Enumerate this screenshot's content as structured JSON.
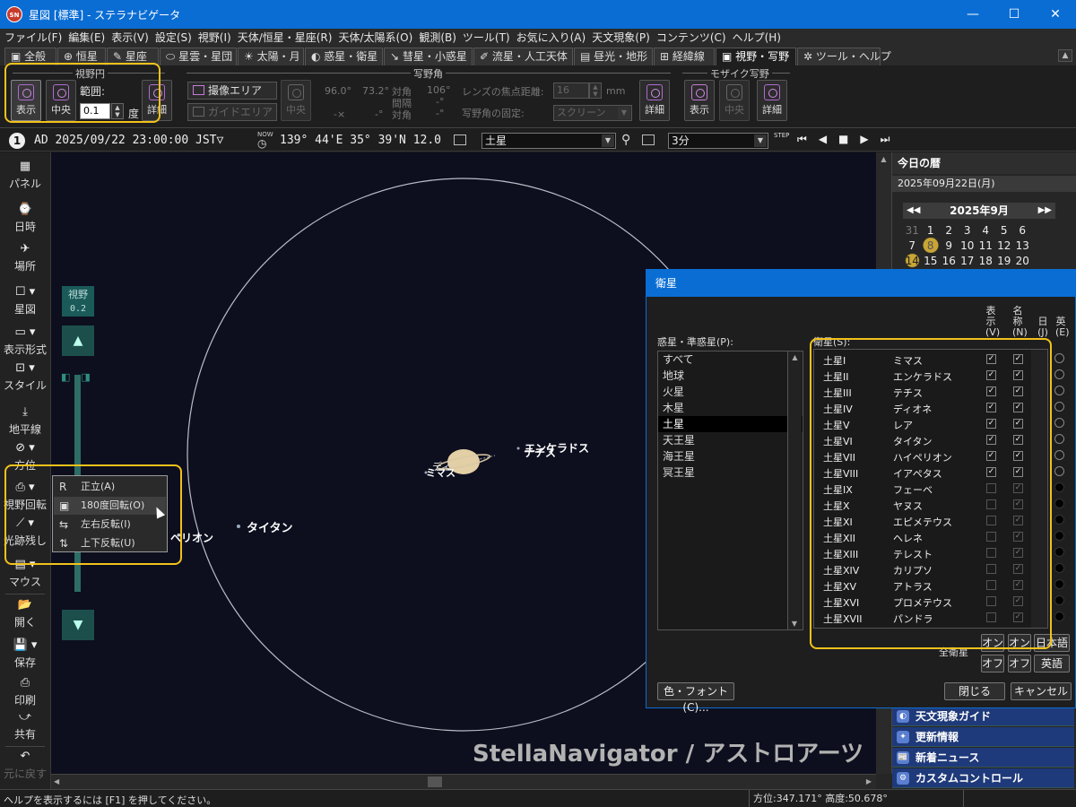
{
  "window": {
    "title": "星図 [標準] - ステラナビゲータ",
    "app_icon": "SN"
  },
  "menu": [
    "ファイル(F)",
    "編集(E)",
    "表示(V)",
    "設定(S)",
    "視野(I)",
    "天体/恒星・星座(R)",
    "天体/太陽系(O)",
    "観測(B)",
    "ツール(T)",
    "お気に入り(A)",
    "天文現象(P)",
    "コンテンツ(C)",
    "ヘルプ(H)"
  ],
  "tabs": [
    "全般",
    "恒星",
    "星座",
    "星雲・星団",
    "太陽・月",
    "惑星・衛星",
    "彗星・小惑星",
    "流星・人工天体",
    "昼光・地形",
    "経緯線",
    "視野・写野",
    "ツール・ヘルプ"
  ],
  "active_tab": "視野・写野",
  "ribbon": {
    "fov_circle": {
      "title": "視野円",
      "show": "表示",
      "center": "中央",
      "range_label": "範囲:",
      "range_value": "0.1",
      "unit": "度",
      "detail": "詳細"
    },
    "photo_field": {
      "title": "写野角",
      "capture_area": "撮像エリア",
      "guide_area": "ガイドエリア",
      "center": "中央",
      "w_deg": "96.0°",
      "h_deg": "73.2°",
      "w_x": "-×",
      "h_x": "-°",
      "diag_label": "対角",
      "spacing_label": "間隔",
      "diag_label2": "対角",
      "diag_val": "106°",
      "spacing_val": "-°",
      "diag_val2": "-°",
      "focal_label": "レンズの焦点距離:",
      "focal_value": "16",
      "focal_unit": "mm",
      "fixed_label": "写野角の固定:",
      "fixed_value": "スクリーン",
      "detail": "詳細"
    },
    "mosaic": {
      "title": "モザイク写野",
      "show": "表示",
      "center": "中央",
      "detail": "詳細"
    }
  },
  "status": {
    "step": "1",
    "datetime": "AD 2025/09/22 23:00:00 JST▽",
    "now_label": "NOW",
    "coords": "139° 44'E  35° 39'N  12.0",
    "target": "土星",
    "interval": "3分",
    "step_label": "STEP"
  },
  "leftbar": [
    "パネル",
    "日時",
    "場所",
    "星図",
    "表示形式",
    "スタイル",
    "地平線",
    "方位",
    "視野回転",
    "光跡残し",
    "マウス",
    "開く",
    "保存",
    "印刷",
    "共有",
    "元に戻す"
  ],
  "fov_indicator": {
    "label": "視野",
    "value": "0.2"
  },
  "context_menu": [
    "正立(A)",
    "180度回転(O)",
    "左右反転(I)",
    "上下反転(U)"
  ],
  "sky_labels": {
    "titan": "タイタン",
    "hyperion_partial": "ペリオン",
    "mimas": "ミマス",
    "dione_partial": "ディ",
    "enceladus": "エンケラドス",
    "tethys": "テチス"
  },
  "watermark": "StellaNavigator / アストロアーツ",
  "right_panel": {
    "header": "今日の暦",
    "date": "2025年09月22日(月)",
    "month": "2025年9月",
    "cal_rows": [
      [
        "31",
        "1",
        "2",
        "3",
        "4",
        "5",
        "6"
      ],
      [
        "7",
        "8",
        "9",
        "10",
        "11",
        "12",
        "13"
      ],
      [
        "14",
        "15",
        "16",
        "17",
        "18",
        "19",
        "20"
      ]
    ],
    "links": [
      "天文現象ガイド",
      "更新情報",
      "新着ニュース",
      "カスタムコントロール"
    ]
  },
  "dialog": {
    "title": "衛星",
    "planets_label": "惑星・準惑星(P):",
    "planets": [
      "すべて",
      "地球",
      "火星",
      "木星",
      "土星",
      "天王星",
      "海王星",
      "冥王星"
    ],
    "selected_planet": "土星",
    "sats_label": "衛星(S):",
    "col_show": "表示(V)",
    "col_name": "名称(N)",
    "col_jp": "日(J)",
    "col_en": "英(E)",
    "satellites": [
      {
        "id": "土星I",
        "name": "ミマス",
        "show": true
      },
      {
        "id": "土星II",
        "name": "エンケラドス",
        "show": true
      },
      {
        "id": "土星III",
        "name": "テチス",
        "show": true
      },
      {
        "id": "土星IV",
        "name": "ディオネ",
        "show": true
      },
      {
        "id": "土星V",
        "name": "レア",
        "show": true
      },
      {
        "id": "土星VI",
        "name": "タイタン",
        "show": true
      },
      {
        "id": "土星VII",
        "name": "ハイペリオン",
        "show": true
      },
      {
        "id": "土星VIII",
        "name": "イアペタス",
        "show": true
      },
      {
        "id": "土星IX",
        "name": "フェーベ",
        "show": false
      },
      {
        "id": "土星X",
        "name": "ヤヌス",
        "show": false
      },
      {
        "id": "土星XI",
        "name": "エピメテウス",
        "show": false
      },
      {
        "id": "土星XII",
        "name": "ヘレネ",
        "show": false
      },
      {
        "id": "土星XIII",
        "name": "テレスト",
        "show": false
      },
      {
        "id": "土星XIV",
        "name": "カリプソ",
        "show": false
      },
      {
        "id": "土星XV",
        "name": "アトラス",
        "show": false
      },
      {
        "id": "土星XVI",
        "name": "プロメテウス",
        "show": false
      },
      {
        "id": "土星XVII",
        "name": "パンドラ",
        "show": false
      }
    ],
    "all_sats_label": "全衛星",
    "on": "オン",
    "off": "オフ",
    "japanese": "日本語",
    "english": "英語",
    "color_font": "色・フォント(C)...",
    "close": "閉じる",
    "cancel": "キャンセル"
  },
  "footer": {
    "help": "ヘルプを表示するには [F1] を押してください。",
    "azimuth": "方位:347.171°  高度:50.678°"
  },
  "colors": {
    "accent": "#0a6dd4",
    "highlight": "#f2c21b",
    "sky": "#0d0f1e"
  }
}
